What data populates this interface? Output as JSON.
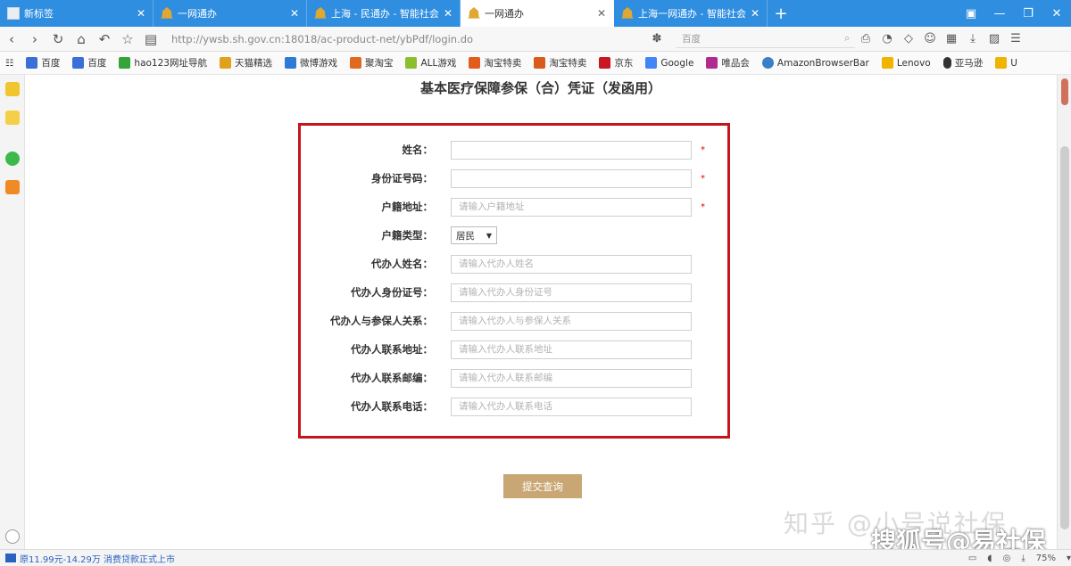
{
  "tabs": [
    {
      "label": "新标签",
      "active": false
    },
    {
      "label": "一网通办",
      "active": false
    },
    {
      "label": "上海 - 民通办 - 智能社会",
      "active": false
    },
    {
      "label": "一网通办",
      "active": true
    },
    {
      "label": "上海一网通办 - 智能社会",
      "active": false
    }
  ],
  "address": {
    "url": "http://ywsb.sh.gov.cn:18018/ac-product-net/ybPdf/login.do",
    "search_placeholder": "百度"
  },
  "bookmarks": [
    {
      "label": "百度",
      "color": "#3a6fd8"
    },
    {
      "label": "百度",
      "color": "#3a6fd8"
    },
    {
      "label": "hao123网址导航",
      "color": "#33a33a"
    },
    {
      "label": "天猫精选",
      "color": "#e0a21b"
    },
    {
      "label": "微博游戏",
      "color": "#2f7ad8"
    },
    {
      "label": "聚淘宝",
      "color": "#e06a1f"
    },
    {
      "label": "ALL游戏",
      "color": "#8cbf2e"
    },
    {
      "label": "淘宝特卖",
      "color": "#e25c1e"
    },
    {
      "label": "淘宝特卖",
      "color": "#d85a1c"
    },
    {
      "label": "京东",
      "color": "#c81623"
    },
    {
      "label": "Google",
      "color": "#4285f4"
    },
    {
      "label": "唯品会",
      "color": "#b02a8f"
    },
    {
      "label": "AmazonBrowserBar",
      "color": "#3b7fc4"
    },
    {
      "label": "Lenovo",
      "color": "#f0b400"
    },
    {
      "label": "亚马逊",
      "color": "#333333"
    },
    {
      "label": "U",
      "color": "#f0b400"
    }
  ],
  "page": {
    "title": "基本医疗保障参保（合）凭证（发函用）",
    "form": {
      "name_label": "姓名：",
      "id_label": "身份证号码：",
      "address_label": "户籍地址：",
      "address_placeholder": "请输入户籍地址",
      "household_label": "户籍类型：",
      "household_value": "居民",
      "agent_name_label": "代办人姓名：",
      "agent_name_placeholder": "请输入代办人姓名",
      "agent_id_label": "代办人身份证号：",
      "agent_id_placeholder": "请输入代办人身份证号",
      "agent_relation_label": "代办人与参保人关系：",
      "agent_relation_placeholder": "请输入代办人与参保人关系",
      "agent_address_label": "代办人联系地址：",
      "agent_address_placeholder": "请输入代办人联系地址",
      "agent_zip_label": "代办人联系邮编：",
      "agent_zip_placeholder": "请输入代办人联系邮编",
      "agent_phone_label": "代办人联系电话：",
      "agent_phone_placeholder": "请输入代办人联系电话",
      "required_mark": "*"
    },
    "submit_label": "提交查询",
    "watermark": "知乎 @小号说社保",
    "sohu_mark": "搜狐号@易社保"
  },
  "status": {
    "left_text": "原11.99元-14.29万 消费贷款正式上市",
    "zoom": "75%"
  },
  "colors": {
    "tab_bar": "#2f8ee0",
    "highlight_border": "#c4141c",
    "submit_button": "#c9a775"
  }
}
